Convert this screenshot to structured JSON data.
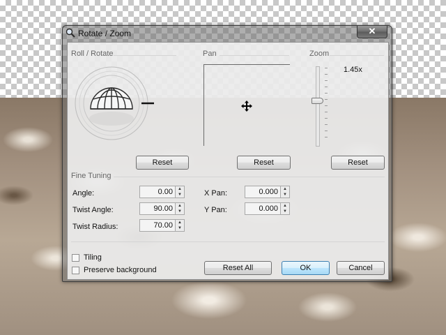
{
  "dialog": {
    "title": "Rotate / Zoom",
    "close_label": "✕"
  },
  "sections": {
    "roll_rotate": "Roll / Rotate",
    "pan": "Pan",
    "zoom": "Zoom",
    "fine_tuning": "Fine Tuning"
  },
  "zoom": {
    "value_label": "1.45x"
  },
  "reset_buttons": {
    "roll": "Reset",
    "pan": "Reset",
    "zoom": "Reset"
  },
  "fine_tuning": {
    "angle_label": "Angle:",
    "angle_value": "0.00",
    "twist_angle_label": "Twist Angle:",
    "twist_angle_value": "90.00",
    "twist_radius_label": "Twist Radius:",
    "twist_radius_value": "70.00",
    "x_pan_label": "X Pan:",
    "x_pan_value": "0.000",
    "y_pan_label": "Y Pan:",
    "y_pan_value": "0.000"
  },
  "options": {
    "tiling_label": "Tiling",
    "preserve_background_label": "Preserve background"
  },
  "buttons": {
    "reset_all": "Reset All",
    "ok": "OK",
    "cancel": "Cancel"
  },
  "icons": {
    "title": "magnifier-icon",
    "pan_cursor": "move-cursor-icon",
    "spin_up": "▲",
    "spin_down": "▼"
  }
}
